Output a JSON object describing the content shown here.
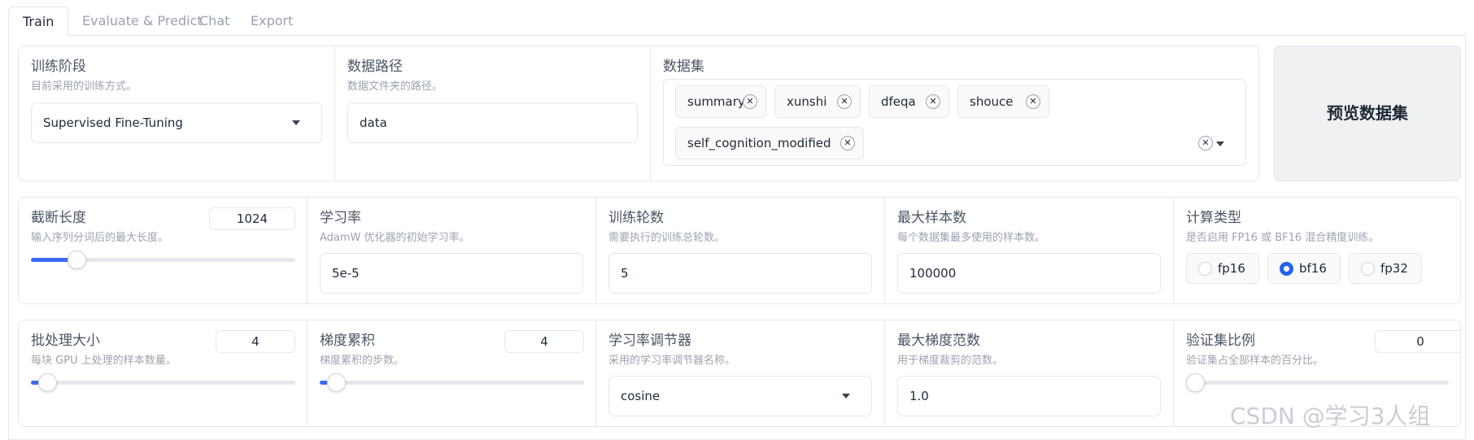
{
  "tabs": [
    "Train",
    "Evaluate & Predict",
    "Chat",
    "Export"
  ],
  "row1": {
    "stage": {
      "label": "训练阶段",
      "desc": "目前采用的训练方式。",
      "value": "Supervised Fine-Tuning"
    },
    "data_path": {
      "label": "数据路径",
      "desc": "数据文件夹的路径。",
      "value": "data"
    },
    "dataset": {
      "label": "数据集",
      "chips": [
        "summary",
        "xunshi",
        "dfeqa",
        "shouce",
        "self_cognition_modified"
      ]
    },
    "preview_button": "预览数据集"
  },
  "row2": {
    "cutoff": {
      "label": "截断长度",
      "desc": "输入序列分词后的最大长度。",
      "value": "1024",
      "slider_fraction": 0.15
    },
    "lr": {
      "label": "学习率",
      "desc": "AdamW 优化器的初始学习率。",
      "value": "5e-5"
    },
    "epochs": {
      "label": "训练轮数",
      "desc": "需要执行的训练总轮数。",
      "value": "5"
    },
    "max_samples": {
      "label": "最大样本数",
      "desc": "每个数据集最多使用的样本数。",
      "value": "100000"
    },
    "compute": {
      "label": "计算类型",
      "desc": "是否启用 FP16 或 BF16 混合精度训练。",
      "options": [
        "fp16",
        "bf16",
        "fp32"
      ],
      "selected": "bf16"
    }
  },
  "row3": {
    "batch": {
      "label": "批处理大小",
      "desc": "每块 GPU 上处理的样本数量。",
      "value": "4",
      "slider_fraction": 0.03
    },
    "grad_accum": {
      "label": "梯度累积",
      "desc": "梯度累积的步数。",
      "value": "4",
      "slider_fraction": 0.03
    },
    "scheduler": {
      "label": "学习率调节器",
      "desc": "采用的学习率调节器名称。",
      "value": "cosine"
    },
    "max_grad": {
      "label": "最大梯度范数",
      "desc": "用于梯度裁剪的范数。",
      "value": "1.0"
    },
    "val_size": {
      "label": "验证集比例",
      "desc": "验证集占全部样本的百分比。",
      "value": "0",
      "slider_fraction": 0.0
    }
  },
  "watermark": "CSDN @学习3人组",
  "colors": {
    "accent": "#2563eb",
    "slider_fill": "#3b6bf2",
    "border": "#e5e7eb"
  }
}
